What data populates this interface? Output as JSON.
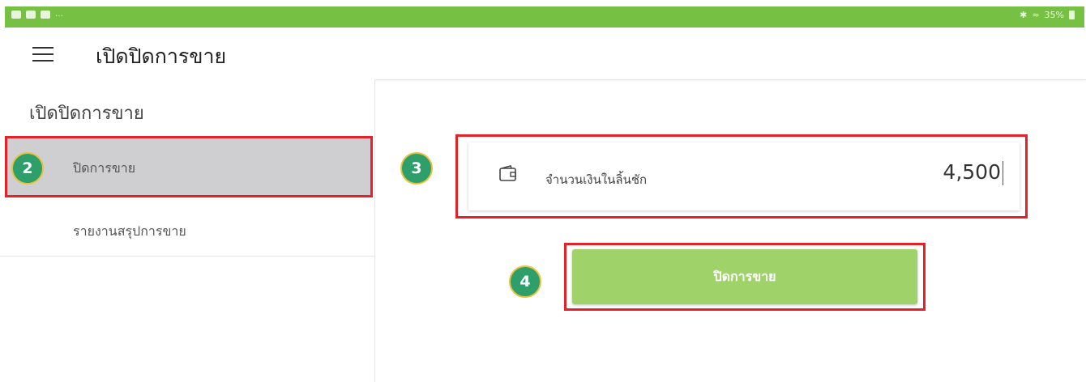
{
  "appbar": {
    "title": "เปิดปิดการขาย",
    "menu_icon": "hamburger-menu-icon"
  },
  "status_bar": {
    "right_text": "35%",
    "icons": [
      "image-icon",
      "cast-icon",
      "media-icon",
      "bluetooth-icon",
      "wifi-icon",
      "signal-icon",
      "battery-icon"
    ]
  },
  "sidebar": {
    "header": "เปิดปิดการขาย",
    "items": [
      {
        "label": "ปิดการขาย",
        "active": true
      },
      {
        "label": "รายงานสรุปการขาย",
        "active": false
      }
    ]
  },
  "main": {
    "cash_field": {
      "label": "จำนวนเงินในลิ้นชัก",
      "value": "4,500",
      "icon": "wallet-icon"
    },
    "close_sale_button": "ปิดการขาย"
  },
  "annotations": {
    "badges": [
      "2",
      "3",
      "4"
    ],
    "highlight_color": "#e5222a",
    "badge_color": "#2e9e6b"
  },
  "colors": {
    "status_bar": "#76c043",
    "button": "#9fd36a",
    "active_item": "#cfcfd2"
  }
}
